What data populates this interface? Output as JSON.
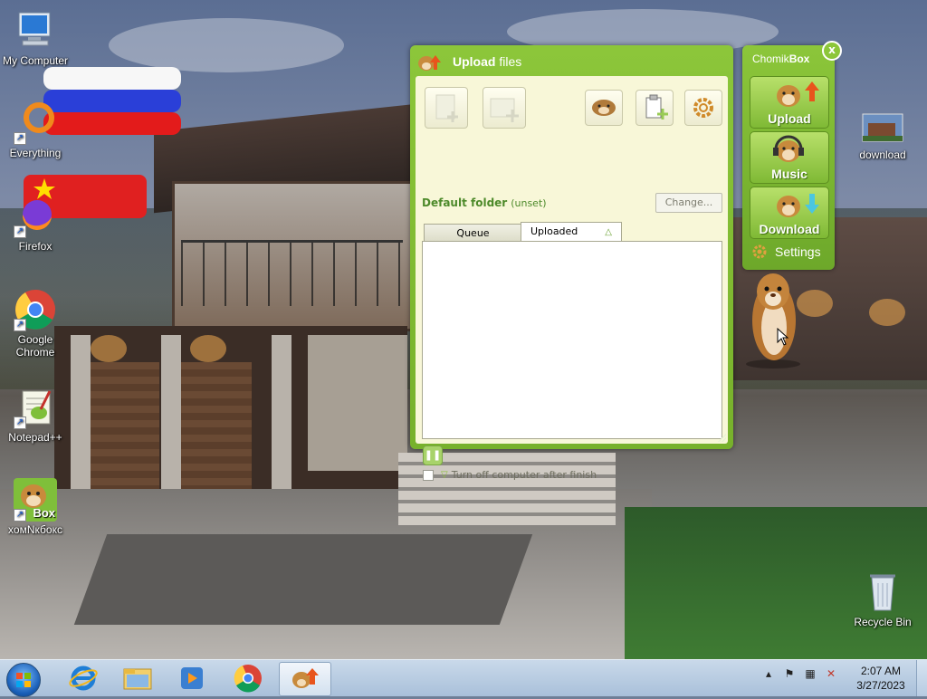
{
  "desktop": {
    "icons": [
      {
        "id": "my-computer",
        "label": "My Computer"
      },
      {
        "id": "everything",
        "label": "Everything"
      },
      {
        "id": "firefox",
        "label": "Firefox"
      },
      {
        "id": "google-chrome",
        "label": "Google Chrome"
      },
      {
        "id": "notepad-plus-plus",
        "label": "Notepad++"
      },
      {
        "id": "chomikbox",
        "label": "хомNкбокс"
      },
      {
        "id": "download",
        "label": "download"
      },
      {
        "id": "recycle-bin",
        "label": "Recycle Bin"
      }
    ],
    "chomikbox_icon_badge": "Box"
  },
  "upload_window": {
    "title_bold": "Upload",
    "title_rest": " files",
    "toolbar_icons": [
      "add-file-icon",
      "add-folder-icon",
      "hamster-icon",
      "clipboard-add-icon",
      "gear-icon"
    ],
    "default_folder_label": "Default folder",
    "default_folder_value": "(unset)",
    "change_button": "Change...",
    "tabs": [
      {
        "label": "Queue",
        "active": false
      },
      {
        "label": "Uploaded",
        "active": true
      }
    ],
    "pause_icon": "pause-icon",
    "turn_off_label": "Turn off computer after finish",
    "turn_off_checked": false
  },
  "widget": {
    "title_plain": "Chomik",
    "title_bold": "Box",
    "close_label": "x",
    "buttons": [
      {
        "label": "Upload",
        "icon": "upload-arrow-icon"
      },
      {
        "label": "Music",
        "icon": "headphones-icon"
      },
      {
        "label": "Download",
        "icon": "download-arrow-icon"
      }
    ],
    "settings_label": "Settings"
  },
  "taskbar": {
    "items": [
      "internet-explorer",
      "windows-explorer",
      "windows-media-player",
      "google-chrome",
      "chomikbox"
    ],
    "active_item": "chomikbox",
    "tray_icons": [
      "show-hidden-icons",
      "action-center-flag-icon",
      "network-icon",
      "volume-muted-icon"
    ],
    "time": "2:07 AM",
    "date": "3/27/2023"
  },
  "colors": {
    "chomik_green": "#8cc63a",
    "chomik_panel": "#f8f7d8",
    "folder_text": "#4d8a2a"
  }
}
